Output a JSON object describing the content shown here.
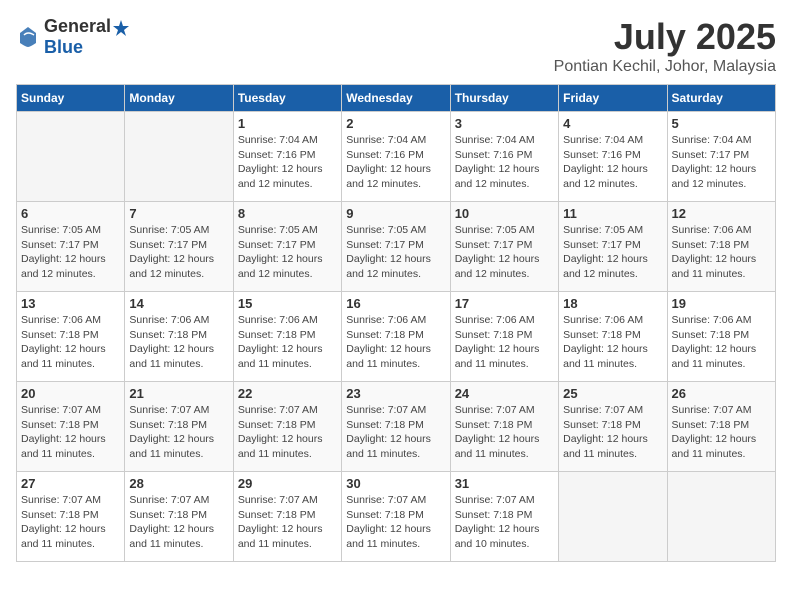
{
  "header": {
    "logo_general": "General",
    "logo_blue": "Blue",
    "month_title": "July 2025",
    "location": "Pontian Kechil, Johor, Malaysia"
  },
  "days_of_week": [
    "Sunday",
    "Monday",
    "Tuesday",
    "Wednesday",
    "Thursday",
    "Friday",
    "Saturday"
  ],
  "weeks": [
    [
      {
        "day": "",
        "info": ""
      },
      {
        "day": "",
        "info": ""
      },
      {
        "day": "1",
        "info": "Sunrise: 7:04 AM\nSunset: 7:16 PM\nDaylight: 12 hours and 12 minutes."
      },
      {
        "day": "2",
        "info": "Sunrise: 7:04 AM\nSunset: 7:16 PM\nDaylight: 12 hours and 12 minutes."
      },
      {
        "day": "3",
        "info": "Sunrise: 7:04 AM\nSunset: 7:16 PM\nDaylight: 12 hours and 12 minutes."
      },
      {
        "day": "4",
        "info": "Sunrise: 7:04 AM\nSunset: 7:16 PM\nDaylight: 12 hours and 12 minutes."
      },
      {
        "day": "5",
        "info": "Sunrise: 7:04 AM\nSunset: 7:17 PM\nDaylight: 12 hours and 12 minutes."
      }
    ],
    [
      {
        "day": "6",
        "info": "Sunrise: 7:05 AM\nSunset: 7:17 PM\nDaylight: 12 hours and 12 minutes."
      },
      {
        "day": "7",
        "info": "Sunrise: 7:05 AM\nSunset: 7:17 PM\nDaylight: 12 hours and 12 minutes."
      },
      {
        "day": "8",
        "info": "Sunrise: 7:05 AM\nSunset: 7:17 PM\nDaylight: 12 hours and 12 minutes."
      },
      {
        "day": "9",
        "info": "Sunrise: 7:05 AM\nSunset: 7:17 PM\nDaylight: 12 hours and 12 minutes."
      },
      {
        "day": "10",
        "info": "Sunrise: 7:05 AM\nSunset: 7:17 PM\nDaylight: 12 hours and 12 minutes."
      },
      {
        "day": "11",
        "info": "Sunrise: 7:05 AM\nSunset: 7:17 PM\nDaylight: 12 hours and 12 minutes."
      },
      {
        "day": "12",
        "info": "Sunrise: 7:06 AM\nSunset: 7:18 PM\nDaylight: 12 hours and 11 minutes."
      }
    ],
    [
      {
        "day": "13",
        "info": "Sunrise: 7:06 AM\nSunset: 7:18 PM\nDaylight: 12 hours and 11 minutes."
      },
      {
        "day": "14",
        "info": "Sunrise: 7:06 AM\nSunset: 7:18 PM\nDaylight: 12 hours and 11 minutes."
      },
      {
        "day": "15",
        "info": "Sunrise: 7:06 AM\nSunset: 7:18 PM\nDaylight: 12 hours and 11 minutes."
      },
      {
        "day": "16",
        "info": "Sunrise: 7:06 AM\nSunset: 7:18 PM\nDaylight: 12 hours and 11 minutes."
      },
      {
        "day": "17",
        "info": "Sunrise: 7:06 AM\nSunset: 7:18 PM\nDaylight: 12 hours and 11 minutes."
      },
      {
        "day": "18",
        "info": "Sunrise: 7:06 AM\nSunset: 7:18 PM\nDaylight: 12 hours and 11 minutes."
      },
      {
        "day": "19",
        "info": "Sunrise: 7:06 AM\nSunset: 7:18 PM\nDaylight: 12 hours and 11 minutes."
      }
    ],
    [
      {
        "day": "20",
        "info": "Sunrise: 7:07 AM\nSunset: 7:18 PM\nDaylight: 12 hours and 11 minutes."
      },
      {
        "day": "21",
        "info": "Sunrise: 7:07 AM\nSunset: 7:18 PM\nDaylight: 12 hours and 11 minutes."
      },
      {
        "day": "22",
        "info": "Sunrise: 7:07 AM\nSunset: 7:18 PM\nDaylight: 12 hours and 11 minutes."
      },
      {
        "day": "23",
        "info": "Sunrise: 7:07 AM\nSunset: 7:18 PM\nDaylight: 12 hours and 11 minutes."
      },
      {
        "day": "24",
        "info": "Sunrise: 7:07 AM\nSunset: 7:18 PM\nDaylight: 12 hours and 11 minutes."
      },
      {
        "day": "25",
        "info": "Sunrise: 7:07 AM\nSunset: 7:18 PM\nDaylight: 12 hours and 11 minutes."
      },
      {
        "day": "26",
        "info": "Sunrise: 7:07 AM\nSunset: 7:18 PM\nDaylight: 12 hours and 11 minutes."
      }
    ],
    [
      {
        "day": "27",
        "info": "Sunrise: 7:07 AM\nSunset: 7:18 PM\nDaylight: 12 hours and 11 minutes."
      },
      {
        "day": "28",
        "info": "Sunrise: 7:07 AM\nSunset: 7:18 PM\nDaylight: 12 hours and 11 minutes."
      },
      {
        "day": "29",
        "info": "Sunrise: 7:07 AM\nSunset: 7:18 PM\nDaylight: 12 hours and 11 minutes."
      },
      {
        "day": "30",
        "info": "Sunrise: 7:07 AM\nSunset: 7:18 PM\nDaylight: 12 hours and 11 minutes."
      },
      {
        "day": "31",
        "info": "Sunrise: 7:07 AM\nSunset: 7:18 PM\nDaylight: 12 hours and 10 minutes."
      },
      {
        "day": "",
        "info": ""
      },
      {
        "day": "",
        "info": ""
      }
    ]
  ]
}
